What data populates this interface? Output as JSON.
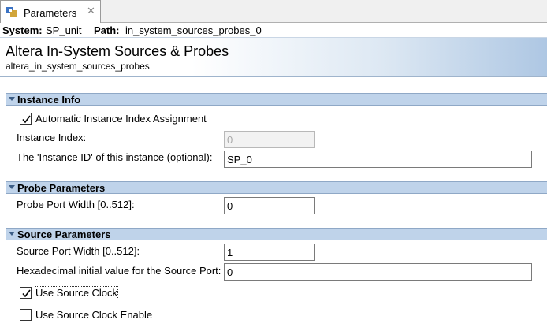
{
  "tab": {
    "label": "Parameters",
    "close_glyph": "✕",
    "icon": "parameters-icon",
    "close_icon": "close-icon"
  },
  "pathbar": {
    "system_key": "System:",
    "system_value": "SP_unit",
    "path_key": "Path:",
    "path_value": "in_system_sources_probes_0"
  },
  "header": {
    "title": "Altera In-System Sources & Probes",
    "subtitle": "altera_in_system_sources_probes"
  },
  "sections": {
    "instance_info": {
      "title": "Instance Info",
      "auto_index_label": "Automatic Instance Index Assignment",
      "auto_index_checked": true,
      "instance_index_label": "Instance Index:",
      "instance_index_value": "0",
      "instance_id_label": "The 'Instance ID' of this instance (optional):",
      "instance_id_value": "SP_0"
    },
    "probe_parameters": {
      "title": "Probe Parameters",
      "probe_width_label": "Probe Port Width [0..512]:",
      "probe_width_value": "0"
    },
    "source_parameters": {
      "title": "Source Parameters",
      "source_width_label": "Source Port Width [0..512]:",
      "source_width_value": "1",
      "hex_initial_label": "Hexadecimal initial value for the Source Port:",
      "hex_initial_value": "0",
      "use_clock_label": "Use Source Clock",
      "use_clock_checked": true,
      "use_clock_enable_label": "Use Source Clock Enable",
      "use_clock_enable_checked": false
    }
  },
  "colors": {
    "section_bg": "#bfd3ea",
    "header_gradient_end": "#aec7e3"
  }
}
